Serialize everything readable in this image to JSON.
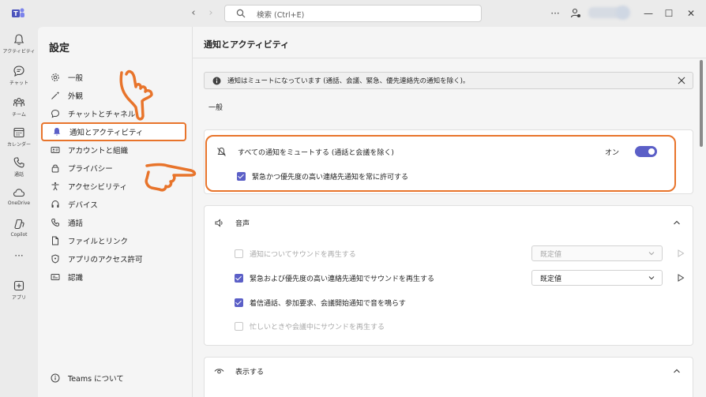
{
  "titlebar": {
    "search_placeholder": "検索 (Ctrl+E)",
    "more_label": "···",
    "minimize": "—",
    "maximize": "☐",
    "close": "✕"
  },
  "rail": {
    "items": [
      {
        "label": "アクティビティ",
        "icon": "bell-icon"
      },
      {
        "label": "チャット",
        "icon": "chat-icon"
      },
      {
        "label": "チーム",
        "icon": "teams-icon"
      },
      {
        "label": "カレンダー",
        "icon": "calendar-icon"
      },
      {
        "label": "通話",
        "icon": "phone-icon"
      },
      {
        "label": "OneDrive",
        "icon": "cloud-icon"
      },
      {
        "label": "Copilot",
        "icon": "copilot-icon"
      },
      {
        "label": "アプリ",
        "icon": "add-app-icon"
      }
    ],
    "more": "···"
  },
  "settings": {
    "title": "設定",
    "items": [
      {
        "label": "一般",
        "icon": "gear-icon"
      },
      {
        "label": "外観",
        "icon": "wand-icon"
      },
      {
        "label": "チャットとチャネル",
        "icon": "chat-icon"
      },
      {
        "label": "通知とアクティビティ",
        "icon": "bell-icon",
        "active": true
      },
      {
        "label": "アカウントと組織",
        "icon": "id-card-icon"
      },
      {
        "label": "プライバシー",
        "icon": "lock-icon"
      },
      {
        "label": "アクセシビリティ",
        "icon": "accessibility-icon"
      },
      {
        "label": "デバイス",
        "icon": "headset-icon"
      },
      {
        "label": "通話",
        "icon": "phone-icon"
      },
      {
        "label": "ファイルとリンク",
        "icon": "file-icon"
      },
      {
        "label": "アプリのアクセス許可",
        "icon": "shield-icon"
      },
      {
        "label": "認識",
        "icon": "caption-icon"
      }
    ],
    "about": "Teams について"
  },
  "main": {
    "title": "通知とアクティビティ",
    "banner": "通知はミュートになっています (通話、会議、緊急、優先連絡先の通知を除く)。",
    "section_general": "一般",
    "mute_card": {
      "mute_label": "すべての通知をミュートする (通話と会議を除く)",
      "toggle_label": "オン",
      "toggle_on": true,
      "urgent_label": "緊急かつ優先度の高い連絡先通知を常に許可する",
      "urgent_checked": true
    },
    "sound_card": {
      "title": "音声",
      "options": [
        {
          "label": "通知についてサウンドを再生する",
          "checked": false,
          "disabled": true,
          "dropdown": "既定値",
          "dropdown_disabled": true
        },
        {
          "label": "緊急および優先度の高い連絡先通知でサウンドを再生する",
          "checked": true,
          "disabled": false,
          "dropdown": "既定値",
          "dropdown_disabled": false
        },
        {
          "label": "着信通話、参加要求、会議開始通知で音を鳴らす",
          "checked": true,
          "disabled": false
        },
        {
          "label": "忙しいときや会議中にサウンドを再生する",
          "checked": false,
          "disabled": true
        }
      ]
    },
    "display_card": {
      "title": "表示する"
    }
  },
  "colors": {
    "accent": "#5b5fc7",
    "highlight": "#e8742b"
  }
}
